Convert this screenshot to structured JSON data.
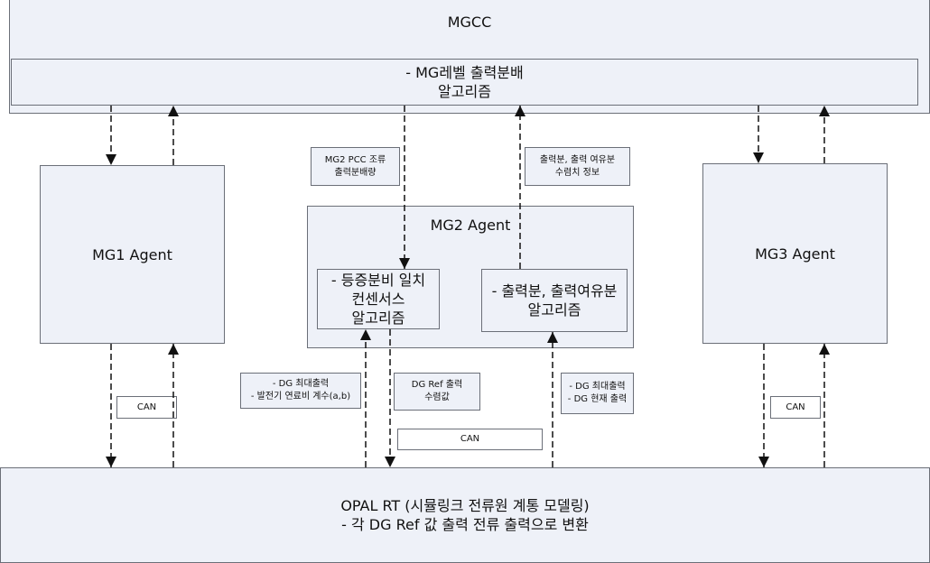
{
  "mgcc": {
    "title": "MGCC",
    "algorithm": "- MG레벨 출력분배\n알고리즘"
  },
  "mg1": {
    "title": "MG1 Agent"
  },
  "mg3": {
    "title": "MG3 Agent"
  },
  "mg2": {
    "title": "MG2 Agent",
    "algo_left": "- 등증분비 일치\n컨센서스\n알고리즘",
    "algo_right": "- 출력분, 출력여유분\n알고리즘"
  },
  "labels": {
    "pcc": "MG2 PCC 조류\n출력분배량",
    "convergence": "출력분, 출력 여유분\n수렴치 정보",
    "dg_left": "- DG 최대출력\n- 발전기 연료비 계수(a,b)",
    "dg_ref": "DG Ref 출력\n수렴값",
    "dg_right": "- DG 최대출력\n- DG 현재 출력",
    "can1": "CAN",
    "can2": "CAN",
    "can3": "CAN"
  },
  "opal": {
    "text": "OPAL RT (시뮬링크 전류원 계통 모델링)\n- 각 DG Ref 값 출력 전류 출력으로 변환"
  },
  "colors": {
    "fill": "#eef1f8",
    "border": "#6b6f78"
  }
}
